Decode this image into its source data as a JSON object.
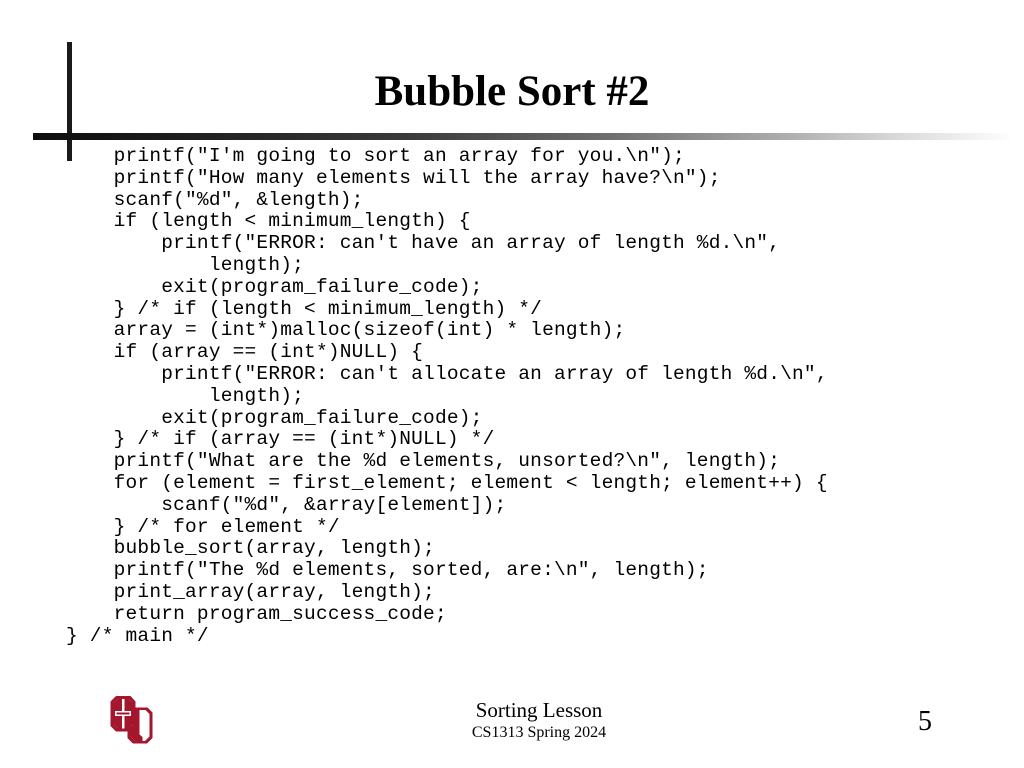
{
  "slide": {
    "title": "Bubble Sort #2",
    "page_number": "5"
  },
  "code": {
    "language": "c",
    "lines": [
      "    printf(\"I'm going to sort an array for you.\\n\");",
      "    printf(\"How many elements will the array have?\\n\");",
      "    scanf(\"%d\", &length);",
      "    if (length < minimum_length) {",
      "        printf(\"ERROR: can't have an array of length %d.\\n\",",
      "            length);",
      "        exit(program_failure_code);",
      "    } /* if (length < minimum_length) */",
      "    array = (int*)malloc(sizeof(int) * length);",
      "    if (array == (int*)NULL) {",
      "        printf(\"ERROR: can't allocate an array of length %d.\\n\",",
      "            length);",
      "        exit(program_failure_code);",
      "    } /* if (array == (int*)NULL) */",
      "    printf(\"What are the %d elements, unsorted?\\n\", length);",
      "    for (element = first_element; element < length; element++) {",
      "        scanf(\"%d\", &array[element]);",
      "    } /* for element */",
      "    bubble_sort(array, length);",
      "    printf(\"The %d elements, sorted, are:\\n\", length);",
      "    print_array(array, length);",
      "    return program_success_code;",
      "} /* main */"
    ]
  },
  "footer": {
    "logo_alt": "University of Oklahoma interlocking OU logo",
    "logo_color": "#A3162C",
    "lesson": "Sorting Lesson",
    "course": "CS1313 Spring 2024"
  },
  "colors": {
    "text": "#000000",
    "background": "#FFFFFF",
    "rule_dark": "#1A1A1A",
    "crimson": "#A3162C"
  }
}
